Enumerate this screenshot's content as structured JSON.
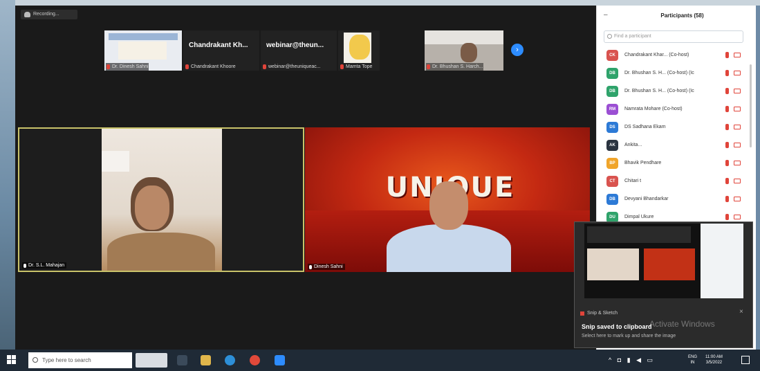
{
  "recording": {
    "label": "Recording..."
  },
  "thumbnails": [
    {
      "label": "Dr. Dinesh Sahni"
    },
    {
      "display_name": "Chandrakant Kh...",
      "label": "Chandrakant Khoore"
    },
    {
      "display_name": "webinar@theun...",
      "label": "webinar@theuniqueac..."
    },
    {
      "label": "Mamta Tope"
    },
    {
      "label": "Dr. Bhushan S. Harch..."
    }
  ],
  "main_tiles": {
    "left_label": "Dr. S.L. Mahajan",
    "right_label": "Dinesh Sahni",
    "logo_text": "UNIQUE"
  },
  "participants": {
    "title": "Participants (58)",
    "search_placeholder": "Find a participant",
    "items": [
      {
        "initials": "CK",
        "name": "Chandrakant Khar... (Co-host)",
        "color": "#d9534f"
      },
      {
        "initials": "DB",
        "name": "Dr. Bhushan S. H... (Co-host) (Ic",
        "color": "#2fa36b"
      },
      {
        "initials": "DB",
        "name": "Dr. Bhushan S. H... (Co-host) (Ic",
        "color": "#2fa36b"
      },
      {
        "initials": "RM",
        "name": "Namrata Mohare (Co-host)",
        "color": "#9b4fd3"
      },
      {
        "initials": "DS",
        "name": "DS Sadhana Ekam",
        "color": "#2d7ad6"
      },
      {
        "initials": "AK",
        "name": "Ankita...",
        "color": "#2b3440"
      },
      {
        "initials": "BP",
        "name": "Bhavik Pendhare",
        "color": "#f0a52b"
      },
      {
        "initials": "CT",
        "name": "Chitari t",
        "color": "#d9534f"
      },
      {
        "initials": "DB",
        "name": "Devyani Bhandarkar",
        "color": "#2d7ad6"
      },
      {
        "initials": "DU",
        "name": "Dimpal Ukure",
        "color": "#2fa36b"
      }
    ]
  },
  "snip": {
    "app": "Snip & Sketch",
    "title": "Snip saved to clipboard",
    "subtitle": "Select here to mark up and share the image",
    "watermark": "Activate Windows"
  },
  "taskbar": {
    "search_placeholder": "Type here to search",
    "lang": "ENG",
    "lang_sub": "IN",
    "time": "11:00 AM",
    "date": "3/5/2022"
  }
}
